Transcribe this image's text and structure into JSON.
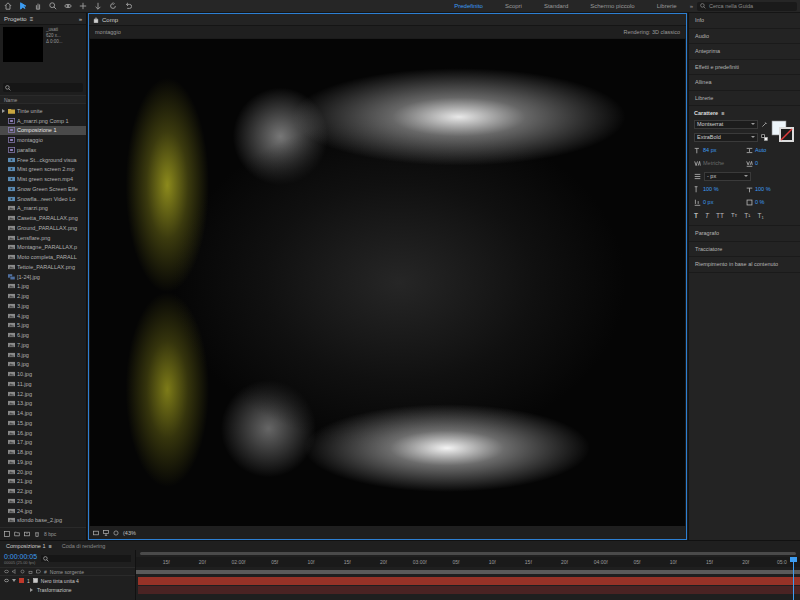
{
  "toolbar": {
    "tools": [
      {
        "kind": "home",
        "selected": false
      },
      {
        "kind": "selection",
        "selected": true
      },
      {
        "kind": "hand",
        "selected": false
      },
      {
        "kind": "zoom",
        "selected": false
      },
      {
        "kind": "orbit",
        "selected": false
      },
      {
        "kind": "move",
        "selected": false
      },
      {
        "kind": "dolly",
        "selected": false
      },
      {
        "kind": "rotate",
        "selected": false
      },
      {
        "kind": "undo",
        "selected": false
      }
    ],
    "workspaces": [
      {
        "label": "Predefinito",
        "selected": true
      },
      {
        "label": "Scopri",
        "selected": false
      },
      {
        "label": "Standard",
        "selected": false
      },
      {
        "label": "Schermo piccolo",
        "selected": false
      },
      {
        "label": "Librerie",
        "selected": false
      }
    ],
    "overflow": "»",
    "search": {
      "placeholder": "Cerca nella Guida"
    }
  },
  "project": {
    "title": "Progetto",
    "menu": "≡",
    "overflow": "»",
    "preview": {
      "name": "_usati",
      "size": "620 x...",
      "duration": "Δ 0:00..."
    },
    "column": "Name",
    "bit_depth": "8 bpc",
    "items": [
      {
        "name": "Tinte unite",
        "kind": "folder",
        "selected": false
      },
      {
        "name": "A_marzi.png Comp 1",
        "kind": "comp",
        "selected": false
      },
      {
        "name": "Composizione 1",
        "kind": "comp",
        "selected": true
      },
      {
        "name": "montaggio",
        "kind": "comp",
        "selected": false
      },
      {
        "name": "parallax",
        "kind": "comp",
        "selected": false
      },
      {
        "name": "Free St...ckground visua",
        "kind": "video",
        "selected": false
      },
      {
        "name": "Mist green screen 2.mp",
        "kind": "video",
        "selected": false
      },
      {
        "name": "Mist green screen.mp4",
        "kind": "video",
        "selected": false
      },
      {
        "name": "Snow Green Screen Effe",
        "kind": "video",
        "selected": false
      },
      {
        "name": "Snowfla...reen Video Lo",
        "kind": "video",
        "selected": false
      },
      {
        "name": "A_marzi.png",
        "kind": "image",
        "selected": false
      },
      {
        "name": "Casetta_PARALLAX.png",
        "kind": "image",
        "selected": false
      },
      {
        "name": "Ground_PARALLAX.png",
        "kind": "image",
        "selected": false
      },
      {
        "name": "Lensflare.png",
        "kind": "image",
        "selected": false
      },
      {
        "name": "Montagne_PARALLAX.p",
        "kind": "image",
        "selected": false
      },
      {
        "name": "Moto completa_PARALL",
        "kind": "image",
        "selected": false
      },
      {
        "name": "Tettoie_PARALLAX.png",
        "kind": "image",
        "selected": false
      },
      {
        "name": "[1-24].jpg",
        "kind": "sequence",
        "selected": false
      },
      {
        "name": "1.jpg",
        "kind": "image",
        "selected": false
      },
      {
        "name": "2.jpg",
        "kind": "image",
        "selected": false
      },
      {
        "name": "3.jpg",
        "kind": "image",
        "selected": false
      },
      {
        "name": "4.jpg",
        "kind": "image",
        "selected": false
      },
      {
        "name": "5.jpg",
        "kind": "image",
        "selected": false
      },
      {
        "name": "6.jpg",
        "kind": "image",
        "selected": false
      },
      {
        "name": "7.jpg",
        "kind": "image",
        "selected": false
      },
      {
        "name": "8.jpg",
        "kind": "image",
        "selected": false
      },
      {
        "name": "9.jpg",
        "kind": "image",
        "selected": false
      },
      {
        "name": "10.jpg",
        "kind": "image",
        "selected": false
      },
      {
        "name": "11.jpg",
        "kind": "image",
        "selected": false
      },
      {
        "name": "12.jpg",
        "kind": "image",
        "selected": false
      },
      {
        "name": "13.jpg",
        "kind": "image",
        "selected": false
      },
      {
        "name": "14.jpg",
        "kind": "image",
        "selected": false
      },
      {
        "name": "15.jpg",
        "kind": "image",
        "selected": false
      },
      {
        "name": "16.jpg",
        "kind": "image",
        "selected": false
      },
      {
        "name": "17.jpg",
        "kind": "image",
        "selected": false
      },
      {
        "name": "18.jpg",
        "kind": "image",
        "selected": false
      },
      {
        "name": "19.jpg",
        "kind": "image",
        "selected": false
      },
      {
        "name": "20.jpg",
        "kind": "image",
        "selected": false
      },
      {
        "name": "21.jpg",
        "kind": "image",
        "selected": false
      },
      {
        "name": "22.jpg",
        "kind": "image",
        "selected": false
      },
      {
        "name": "23.jpg",
        "kind": "image",
        "selected": false
      },
      {
        "name": "24.jpg",
        "kind": "image",
        "selected": false
      },
      {
        "name": "sfondo base_2.jpg",
        "kind": "image",
        "selected": false
      }
    ]
  },
  "comp": {
    "tab": "Comp",
    "breadcrumb": "montaggio",
    "renderer": "Rendering:",
    "renderer_value": "3D classico",
    "zoom": "(43%"
  },
  "side_panels": {
    "above": [
      "Info",
      "Audio",
      "Anteprima",
      "Effetti e predefiniti",
      "Allinea",
      "Librerie"
    ],
    "below": [
      "Paragrafo",
      "Tracciatore",
      "Riempimento in base al contenuto"
    ],
    "character": {
      "title": "Carattere",
      "menu": "≡",
      "font": "Montserrat",
      "style": "ExtraBold",
      "size": "84 px",
      "leading": "Auto",
      "kerning": "Metriche",
      "kerning_disabled": true,
      "tracking": "0",
      "stroke": "- px",
      "vertical_scale": "100 %",
      "horizontal_scale": "100 %",
      "baseline_shift": "0 px",
      "tsume": "0 %",
      "style_buttons": [
        {
          "label": "T",
          "kind": "bold"
        },
        {
          "label": "T",
          "kind": "italic"
        },
        {
          "label": "TT",
          "kind": "caps"
        },
        {
          "label": "Tт",
          "kind": "smallcaps"
        },
        {
          "label": "T¹",
          "kind": "super"
        },
        {
          "label": "T₁",
          "kind": "sub"
        }
      ]
    }
  },
  "timeline": {
    "tabs": [
      {
        "label": "Composizione 1",
        "selected": true
      },
      {
        "label": "Coda di rendering",
        "selected": false
      }
    ],
    "menu": "≡",
    "timecode": "0:00:00:05",
    "frame_info": "00005 (25.00 fps)",
    "columns": [
      "#",
      "Nome sorgente"
    ],
    "ruler": [
      "15f",
      "20f",
      "02:00f",
      "05f",
      "10f",
      "15f",
      "20f",
      "03:00f",
      "05f",
      "10f",
      "15f",
      "20f",
      "04:00f",
      "05f",
      "10f",
      "15f",
      "20f",
      "05:0"
    ],
    "rows": [
      {
        "number": "1",
        "name": "Nero tinta unita 4",
        "kind": "layer",
        "expanded": true,
        "color": "#c0392b"
      },
      {
        "number": "",
        "name": "Trasformazione",
        "kind": "property",
        "expanded": false,
        "color": "#5a2525"
      }
    ]
  }
}
